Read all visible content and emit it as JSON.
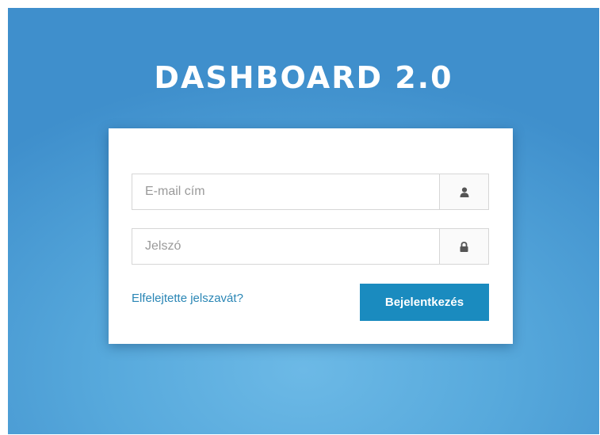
{
  "brand": {
    "title": "DASHBOARD 2.0"
  },
  "form": {
    "email": {
      "placeholder": "E-mail cím",
      "value": "",
      "icon": "user-icon"
    },
    "password": {
      "placeholder": "Jelszó",
      "value": "",
      "icon": "lock-icon"
    },
    "forgot_link": "Elfelejtette jelszavát?",
    "submit_label": "Bejelentkezés"
  },
  "colors": {
    "background": "#4f9fd6",
    "card": "#ffffff",
    "button": "#1a8bbf",
    "link": "#2a86b5"
  }
}
